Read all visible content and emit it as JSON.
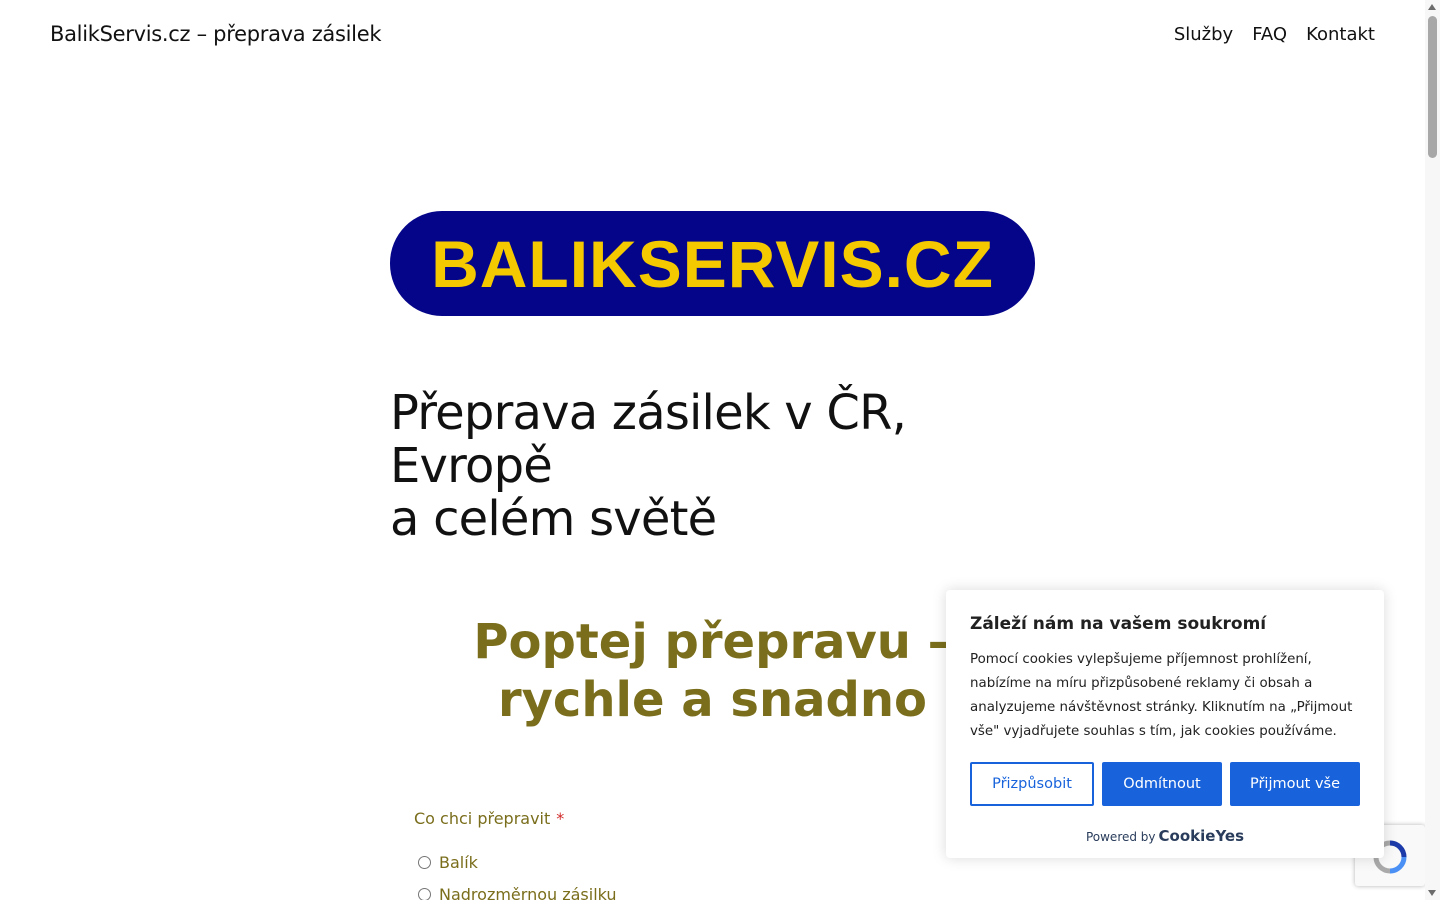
{
  "header": {
    "site_title": "BalikServis.cz – přeprava zásilek",
    "nav": [
      "Služby",
      "FAQ",
      "Kontakt"
    ]
  },
  "logo": {
    "text": "BALIKSERVIS.CZ",
    "bg_color": "#05058a",
    "text_color": "#f5c900"
  },
  "hero": {
    "line1": "Přeprava zásilek v ČR, Evropě",
    "line2": "a celém světě"
  },
  "form": {
    "title_line1": "Poptej přepravu –",
    "title_line2": "rychle a snadno",
    "question_label": "Co chci přepravit",
    "required_mark": "*",
    "options": [
      "Balík",
      "Nadrozměrnou zásilku"
    ],
    "accent_color": "#7a6e1c"
  },
  "cookie_banner": {
    "title": "Záleží nám na vašem soukromí",
    "text": "Pomocí cookies vylepšujeme příjemnost prohlížení, nabízíme na míru přizpůsobené reklamy či obsah a analyzujeme návštěvnost stránky. Kliknutím na „Přijmout vše\" vyjadřujete souhlas s tím, jak cookies používáme.",
    "customize_label": "Přizpůsobit",
    "reject_label": "Odmítnout",
    "accept_label": "Přijmout vše",
    "powered_by": "Powered by",
    "powered_brand": "CookieYes",
    "button_color": "#1863dc"
  },
  "recaptcha": {
    "icon": "recaptcha-icon"
  }
}
